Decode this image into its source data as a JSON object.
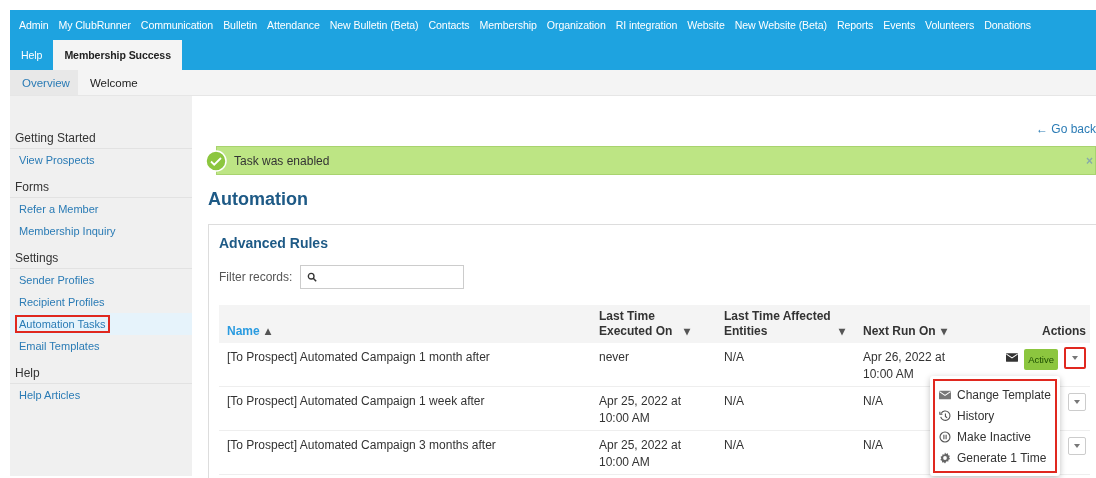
{
  "top_nav": [
    {
      "label": "Admin",
      "selected": false
    },
    {
      "label": "My ClubRunner",
      "selected": false
    },
    {
      "label": "Communication",
      "selected": false
    },
    {
      "label": "Bulletin",
      "selected": false
    },
    {
      "label": "Attendance",
      "selected": false
    },
    {
      "label": "New Bulletin (Beta)",
      "selected": false
    },
    {
      "label": "Contacts",
      "selected": false
    },
    {
      "label": "Membership",
      "selected": false
    },
    {
      "label": "Organization",
      "selected": false
    },
    {
      "label": "RI integration",
      "selected": false
    },
    {
      "label": "Website",
      "selected": false
    },
    {
      "label": "New Website (Beta)",
      "selected": false
    },
    {
      "label": "Reports",
      "selected": false
    },
    {
      "label": "Events",
      "selected": false
    },
    {
      "label": "Volunteers",
      "selected": false
    },
    {
      "label": "Donations",
      "selected": false
    },
    {
      "label": "Help",
      "selected": false
    },
    {
      "label": "Membership Success",
      "selected": true
    }
  ],
  "sub_nav": [
    {
      "label": "Overview",
      "selected": true
    },
    {
      "label": "Welcome",
      "selected": false
    }
  ],
  "sidebar": [
    {
      "heading": "Getting Started",
      "items": [
        {
          "label": "View Prospects",
          "selected": false
        }
      ]
    },
    {
      "heading": "Forms",
      "items": [
        {
          "label": "Refer a Member",
          "selected": false
        },
        {
          "label": "Membership Inquiry",
          "selected": false
        }
      ]
    },
    {
      "heading": "Settings",
      "items": [
        {
          "label": "Sender Profiles",
          "selected": false
        },
        {
          "label": "Recipient Profiles",
          "selected": false
        },
        {
          "label": "Automation Tasks",
          "selected": true
        },
        {
          "label": "Email Templates",
          "selected": false
        }
      ]
    },
    {
      "heading": "Help",
      "items": [
        {
          "label": "Help Articles",
          "selected": false
        }
      ]
    }
  ],
  "go_back": "← Go back",
  "alert": {
    "message": "Task was enabled",
    "close": "×"
  },
  "title": "Automation",
  "panel": {
    "title": "Advanced Rules",
    "filter_label": "Filter records:"
  },
  "table": {
    "columns": [
      {
        "label": "Name",
        "sort_arrow": "▴",
        "active": true
      },
      {
        "label": "Last Time Executed On",
        "sort_arrow": "▾",
        "active": false
      },
      {
        "label": "Last Time Affected Entities",
        "sort_arrow": "▾",
        "active": false
      },
      {
        "label": "Next Run On",
        "sort_arrow": "▾",
        "active": false
      },
      {
        "label": "Actions",
        "active": false
      }
    ],
    "rows": [
      {
        "name": "[To Prospect] Automated Campaign 1 month after",
        "executed": "never",
        "affected": "N/A",
        "next_run": "Apr 26, 2022 at 10:00 AM",
        "status": "Active",
        "toggle_highlighted": true
      },
      {
        "name": "[To Prospect] Automated Campaign 1 week after",
        "executed": "Apr 25, 2022 at 10:00 AM",
        "affected": "N/A",
        "next_run": "N/A",
        "toggle_highlighted": false
      },
      {
        "name": "[To Prospect] Automated Campaign 3 months after",
        "executed": "Apr 25, 2022 at 10:00 AM",
        "affected": "N/A",
        "next_run": "N/A",
        "toggle_highlighted": false
      }
    ]
  },
  "dropdown_menu": {
    "highlighted": true,
    "items": [
      {
        "kind": "envelope",
        "label": "Change Template"
      },
      {
        "kind": "history",
        "label": "History"
      },
      {
        "kind": "pause",
        "label": "Make Inactive"
      },
      {
        "kind": "gear",
        "label": "Generate 1 Time"
      }
    ]
  }
}
